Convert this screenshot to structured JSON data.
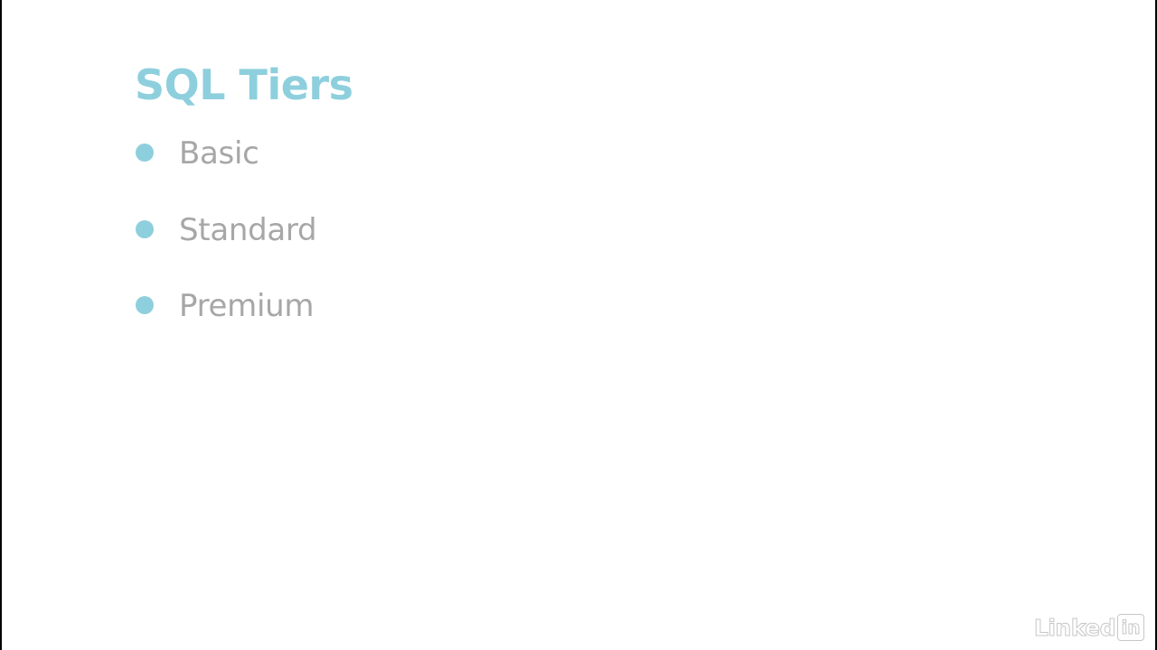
{
  "slide": {
    "title": "SQL Tiers",
    "title_color": "#8ecfdd",
    "bullet_color": "#8ecfdd",
    "text_color": "#a7a7a7",
    "bullets": [
      {
        "label": "Basic"
      },
      {
        "label": "Standard"
      },
      {
        "label": "Premium"
      }
    ]
  },
  "watermark": {
    "brand_word": "Linked",
    "brand_box": "in",
    "icon": "linkedin-logo-icon"
  }
}
